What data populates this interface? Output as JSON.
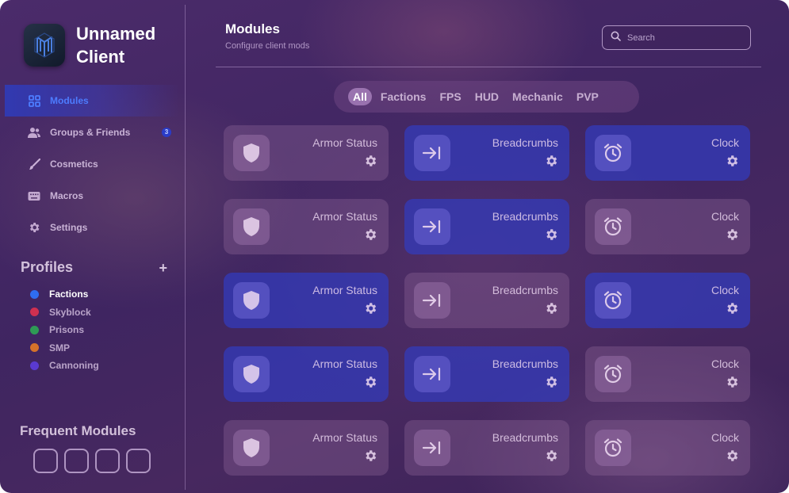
{
  "app": {
    "brand_line1": "Unnamed",
    "brand_line2": "Client"
  },
  "sidebar": {
    "items": [
      {
        "label": "Modules",
        "icon": "grid-icon"
      },
      {
        "label": "Groups & Friends",
        "icon": "users-icon",
        "badge": "3"
      },
      {
        "label": "Cosmetics",
        "icon": "brush-icon"
      },
      {
        "label": "Macros",
        "icon": "keyboard-icon"
      },
      {
        "label": "Settings",
        "icon": "gear-icon"
      }
    ],
    "profiles_title": "Profiles",
    "profiles_add": "+",
    "profiles": [
      {
        "name": "Factions",
        "color": "#2f6cf0"
      },
      {
        "name": "Skyblock",
        "color": "#d03050"
      },
      {
        "name": "Prisons",
        "color": "#2e9a55"
      },
      {
        "name": "SMP",
        "color": "#d5722a"
      },
      {
        "name": "Cannoning",
        "color": "#5a3ad0"
      }
    ],
    "frequent_title": "Frequent Modules"
  },
  "header": {
    "title": "Modules",
    "subtitle": "Configure client mods",
    "search_placeholder": "Search"
  },
  "tabs": [
    "All",
    "Factions",
    "FPS",
    "HUD",
    "Mechanic",
    "PVP"
  ],
  "modules": {
    "rows": [
      [
        {
          "name": "Armor Status",
          "enabled": false
        },
        {
          "name": "Breadcrumbs",
          "enabled": true
        },
        {
          "name": "Clock",
          "enabled": true
        }
      ],
      [
        {
          "name": "Armor Status",
          "enabled": false
        },
        {
          "name": "Breadcrumbs",
          "enabled": true
        },
        {
          "name": "Clock",
          "enabled": false
        }
      ],
      [
        {
          "name": "Armor Status",
          "enabled": true
        },
        {
          "name": "Breadcrumbs",
          "enabled": false
        },
        {
          "name": "Clock",
          "enabled": true
        }
      ],
      [
        {
          "name": "Armor Status",
          "enabled": true
        },
        {
          "name": "Breadcrumbs",
          "enabled": true
        },
        {
          "name": "Clock",
          "enabled": false
        }
      ],
      [
        {
          "name": "Armor Status",
          "enabled": false
        },
        {
          "name": "Breadcrumbs",
          "enabled": false
        },
        {
          "name": "Clock",
          "enabled": false
        }
      ]
    ],
    "icons": [
      "shield-icon",
      "arrow-to-line-icon",
      "alarm-clock-icon"
    ]
  }
}
